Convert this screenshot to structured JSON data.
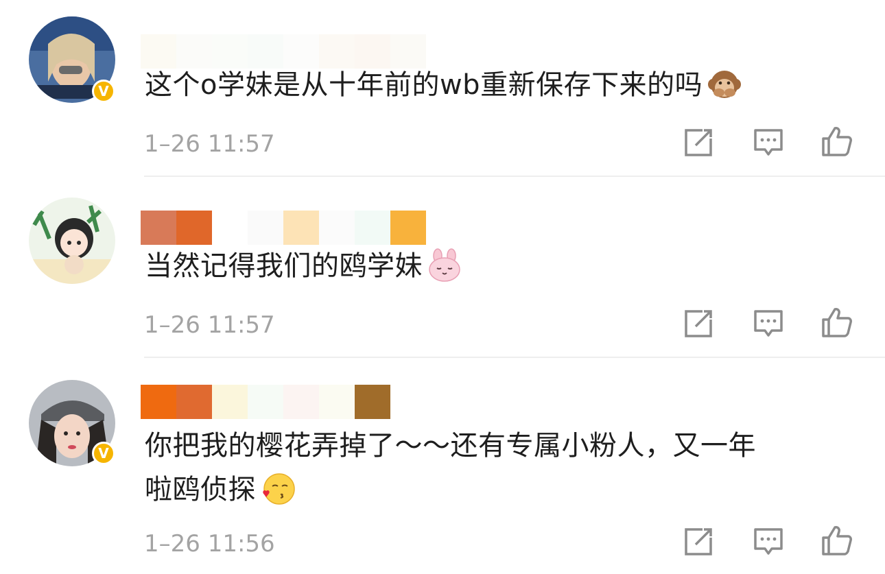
{
  "comments": [
    {
      "text": "这个o学妹是从十年前的wb重新保存下来的吗",
      "emoji": "monkey-covering-mouth-emoji",
      "time": "1–26 11:57",
      "verified": "V"
    },
    {
      "text": "当然记得我们的鸥学妹",
      "emoji": "pink-bunny-emoji",
      "time": "1–26 11:57"
    },
    {
      "text_line1": "你把我的樱花弄掉了～～还有专属小粉人，又一年",
      "text_line2": "啦鸥侦探",
      "emoji": "kissing-face-emoji",
      "time": "1–26 11:56",
      "verified": "V"
    }
  ],
  "colors": {
    "verified_badge": "#f6b500",
    "timestamp": "#a3a3a3",
    "icon": "#8c8c8c",
    "text": "#1e1e1e"
  },
  "icons": [
    "share-icon",
    "comment-icon",
    "like-icon"
  ]
}
